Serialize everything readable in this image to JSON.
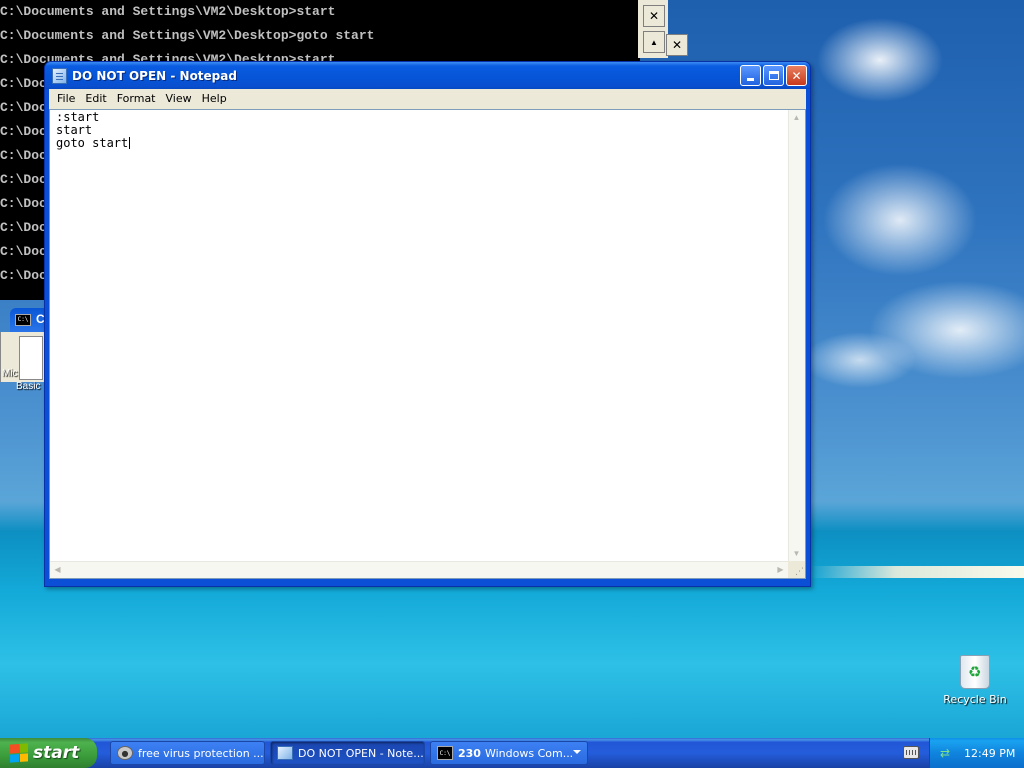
{
  "console": {
    "lines": [
      "C:\\Documents and Settings\\VM2\\Desktop>start",
      "C:\\Documents and Settings\\VM2\\Desktop>goto start",
      "C:\\Documents and Settings\\VM2\\Desktop>start",
      "C:\\Doc",
      "C:\\Doc",
      "C:\\Doc",
      "C:\\Doc",
      "C:\\Doc",
      "C:\\Doc",
      "C:\\Doc",
      "C:\\Doc",
      "C:\\Doc"
    ],
    "close_glyph": "✕",
    "scroll_up_glyph": "▲",
    "cmd_icon_text": "C:\\",
    "partial_title": "C",
    "desktop_label_1": "Mic",
    "desktop_label_2": "Basic"
  },
  "notepad": {
    "title": "DO NOT OPEN - Notepad",
    "menu": [
      "File",
      "Edit",
      "Format",
      "View",
      "Help"
    ],
    "content": ":start\nstart\ngoto start",
    "controls": {
      "close_glyph": "✕"
    },
    "scroll_glyphs": {
      "up": "▲",
      "down": "▼",
      "left": "◀",
      "right": "▶",
      "grip": "⋰"
    }
  },
  "desktop": {
    "recycle_bin_label": "Recycle Bin"
  },
  "taskbar": {
    "start_label": "start",
    "buttons": [
      {
        "label": "free virus protection ...",
        "icon": "browser-icon",
        "active": false
      },
      {
        "label": "DO NOT OPEN - Note...",
        "icon": "notepad-icon",
        "active": true
      },
      {
        "label": "Windows Com...",
        "count": "230",
        "icon": "cmd-icon",
        "active": false
      }
    ],
    "clock": "12:49 PM"
  },
  "colors": {
    "titlebar": "#0a5ce0",
    "taskbar": "#245ddb",
    "start_button": "#3a9c3a",
    "tray": "#0f84de",
    "console_bg": "#000000",
    "console_text": "#c0c0c0"
  }
}
